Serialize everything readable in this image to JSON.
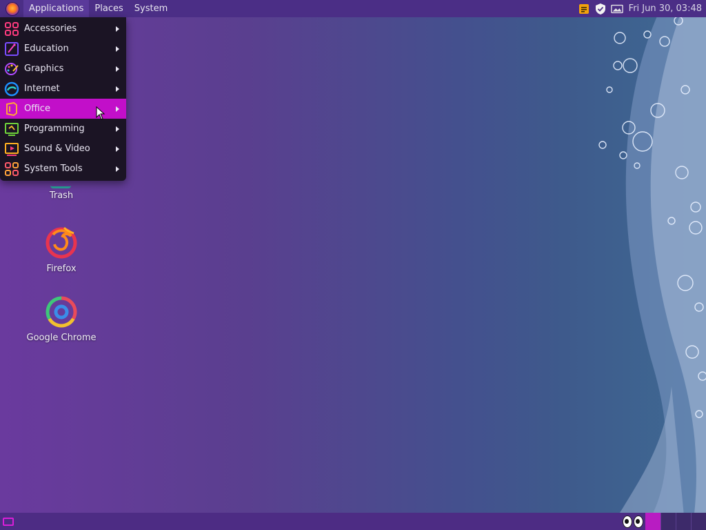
{
  "top_panel": {
    "menus": [
      "Applications",
      "Places",
      "System"
    ],
    "clock": "Fri Jun 30, 03:48",
    "tray_icons": [
      "notes-icon",
      "shield-icon",
      "display-icon"
    ]
  },
  "app_menu": {
    "items": [
      {
        "label": "Accessories",
        "icon": "accessories-icon"
      },
      {
        "label": "Education",
        "icon": "education-icon"
      },
      {
        "label": "Graphics",
        "icon": "graphics-icon"
      },
      {
        "label": "Internet",
        "icon": "internet-icon"
      },
      {
        "label": "Office",
        "icon": "office-icon",
        "highlighted": true
      },
      {
        "label": "Programming",
        "icon": "programming-icon"
      },
      {
        "label": "Sound & Video",
        "icon": "sound-video-icon"
      },
      {
        "label": "System Tools",
        "icon": "system-tools-icon"
      }
    ]
  },
  "desktop_icons": [
    {
      "label": "Trash",
      "icon": "trash-icon"
    },
    {
      "label": "Firefox",
      "icon": "firefox-icon"
    },
    {
      "label": "Google Chrome",
      "icon": "chrome-icon"
    }
  ],
  "colors": {
    "menu_highlight": "#c20fc9",
    "panel": "#4b2e86",
    "menu_bg": "#1b1424"
  }
}
